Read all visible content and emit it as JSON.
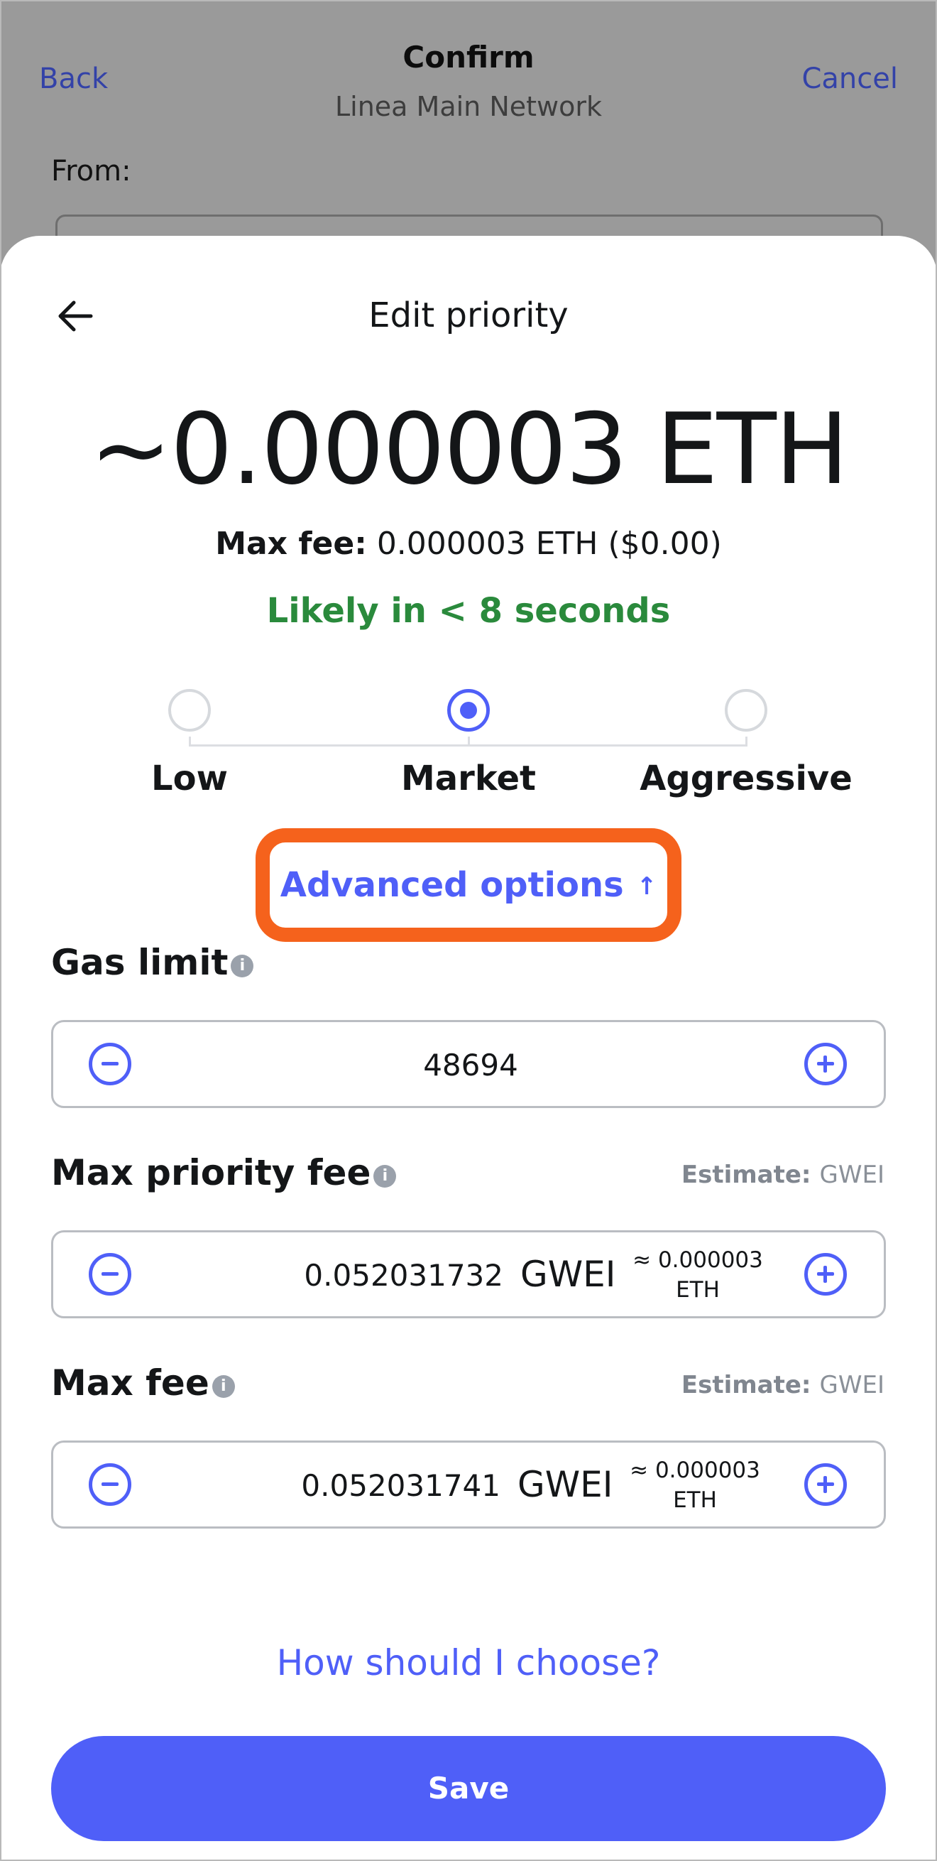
{
  "background": {
    "back_label": "Back",
    "title": "Confirm",
    "network": "Linea Main Network",
    "cancel_label": "Cancel",
    "from_label": "From:"
  },
  "sheet": {
    "title": "Edit priority",
    "amount": "~0.000003 ETH",
    "max_fee_label": "Max fee:",
    "max_fee_value": "0.000003 ETH ($0.00)",
    "likely": "Likely in < 8 seconds",
    "options": [
      "Low",
      "Market",
      "Aggressive"
    ],
    "selected_option": "Market",
    "advanced_label": "Advanced options",
    "advanced_arrow": "↑",
    "gas_limit": {
      "label": "Gas limit",
      "value": "48694"
    },
    "max_priority_fee": {
      "label": "Max priority fee",
      "estimate_label": "Estimate:",
      "estimate_value": "GWEI",
      "value": "0.052031732",
      "unit": "GWEI",
      "conversion_line1": "≈ 0.000003",
      "conversion_line2": "ETH"
    },
    "max_fee": {
      "label": "Max fee",
      "estimate_label": "Estimate:",
      "estimate_value": "GWEI",
      "value": "0.052031741",
      "unit": "GWEI",
      "conversion_line1": "≈ 0.000003",
      "conversion_line2": "ETH"
    },
    "how_to_choose": "How should I choose?",
    "save_label": "Save"
  },
  "colors": {
    "accent": "#4f5ff8",
    "success": "#2a8a3c",
    "highlight": "#f5621c",
    "overlay": "#9a9a9a"
  },
  "icons": [
    "arrow-left-icon",
    "info-icon",
    "minus-circle-icon",
    "plus-circle-icon",
    "arrow-up-icon"
  ]
}
